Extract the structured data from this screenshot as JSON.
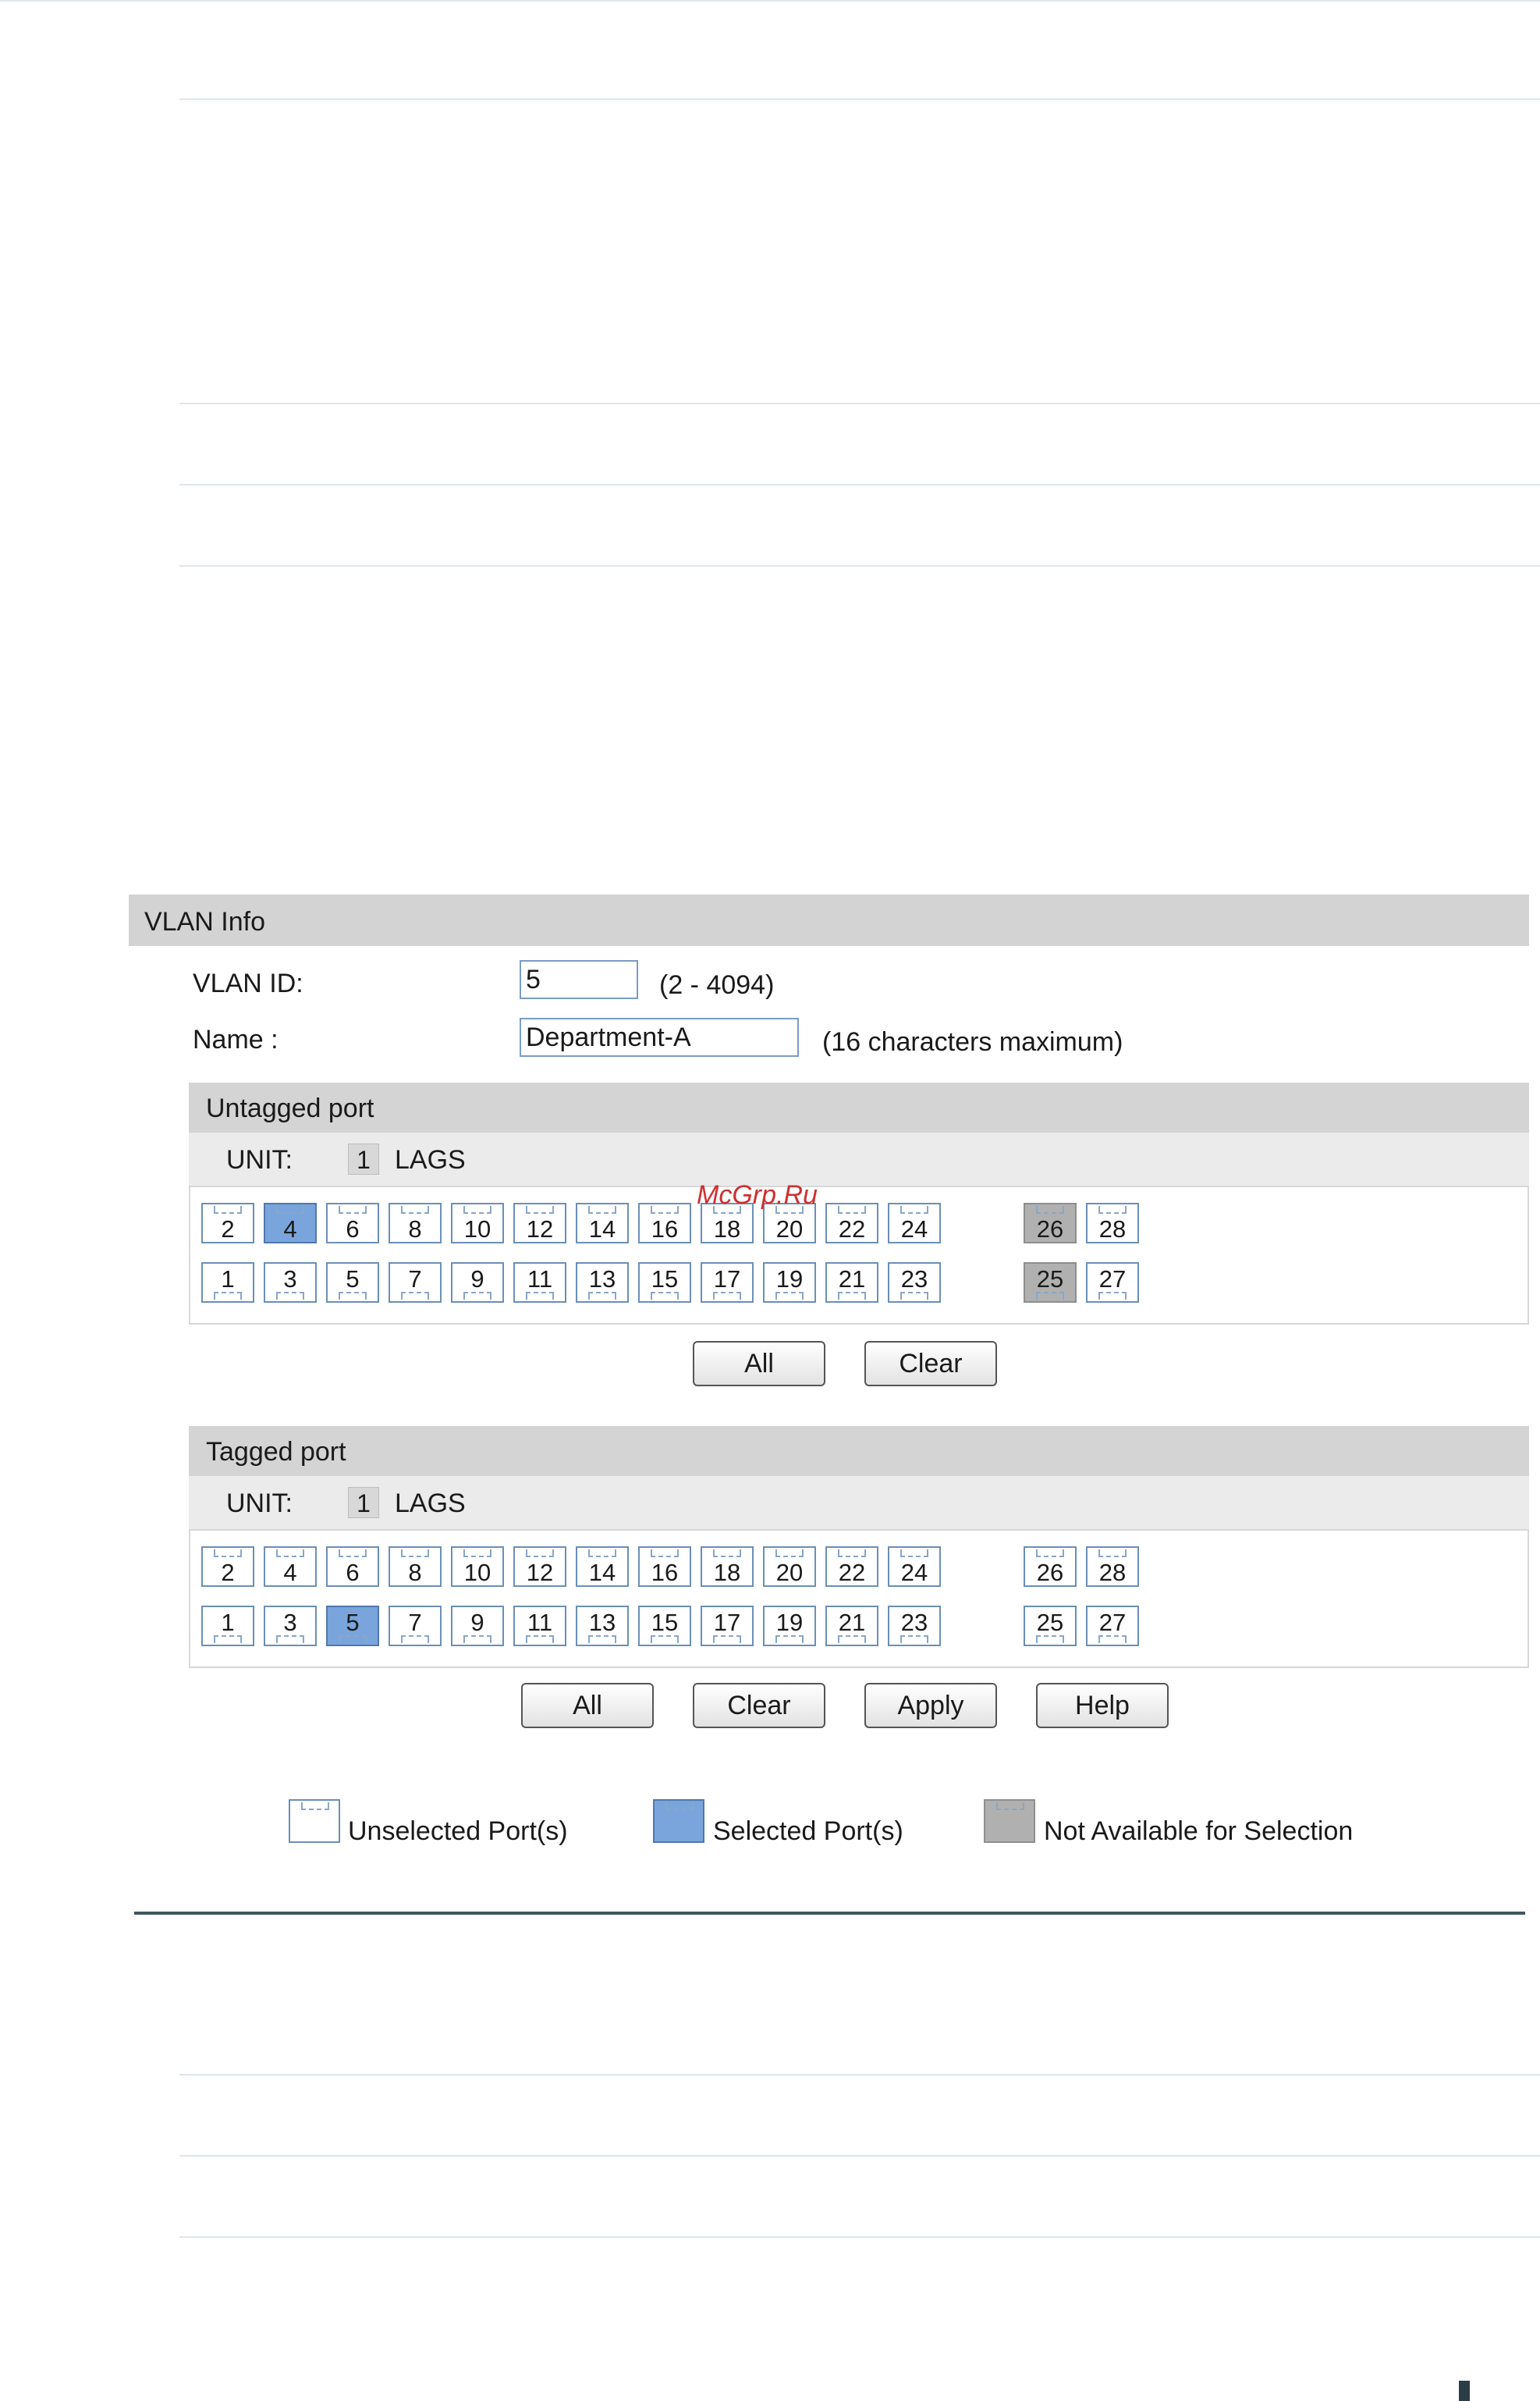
{
  "vlan_info": {
    "header": "VLAN Info",
    "vlan_id_label": "VLAN ID:",
    "vlan_id_value": "5",
    "vlan_id_hint": "(2 - 4094)",
    "name_label": "Name :",
    "name_value": "Department-A",
    "name_hint": "(16 characters maximum)"
  },
  "untagged": {
    "title": "Untagged port",
    "unit_label": "UNIT:",
    "unit_value": "1",
    "lags_label": "LAGS",
    "top_ports": [
      "2",
      "4",
      "6",
      "8",
      "10",
      "12",
      "14",
      "16",
      "18",
      "20",
      "22",
      "24",
      "26",
      "28"
    ],
    "bottom_ports": [
      "1",
      "3",
      "5",
      "7",
      "9",
      "11",
      "13",
      "15",
      "17",
      "19",
      "21",
      "23",
      "25",
      "27"
    ],
    "selected": [
      "4"
    ],
    "disabled": [
      "25",
      "26"
    ],
    "all_label": "All",
    "clear_label": "Clear"
  },
  "tagged": {
    "title": "Tagged port",
    "unit_label": "UNIT:",
    "unit_value": "1",
    "lags_label": "LAGS",
    "top_ports": [
      "2",
      "4",
      "6",
      "8",
      "10",
      "12",
      "14",
      "16",
      "18",
      "20",
      "22",
      "24",
      "26",
      "28"
    ],
    "bottom_ports": [
      "1",
      "3",
      "5",
      "7",
      "9",
      "11",
      "13",
      "15",
      "17",
      "19",
      "21",
      "23",
      "25",
      "27"
    ],
    "selected": [
      "5"
    ],
    "disabled": [],
    "all_label": "All",
    "clear_label": "Clear",
    "apply_label": "Apply",
    "help_label": "Help"
  },
  "legend": {
    "unselected": "Unselected Port(s)",
    "selected": "Selected Port(s)",
    "unavailable": "Not Available for Selection"
  },
  "watermark": "McGrp.Ru",
  "colors": {
    "selected": "#7aa5dc",
    "disabled": "#b0b0b0",
    "header": "#d3d3d3"
  }
}
